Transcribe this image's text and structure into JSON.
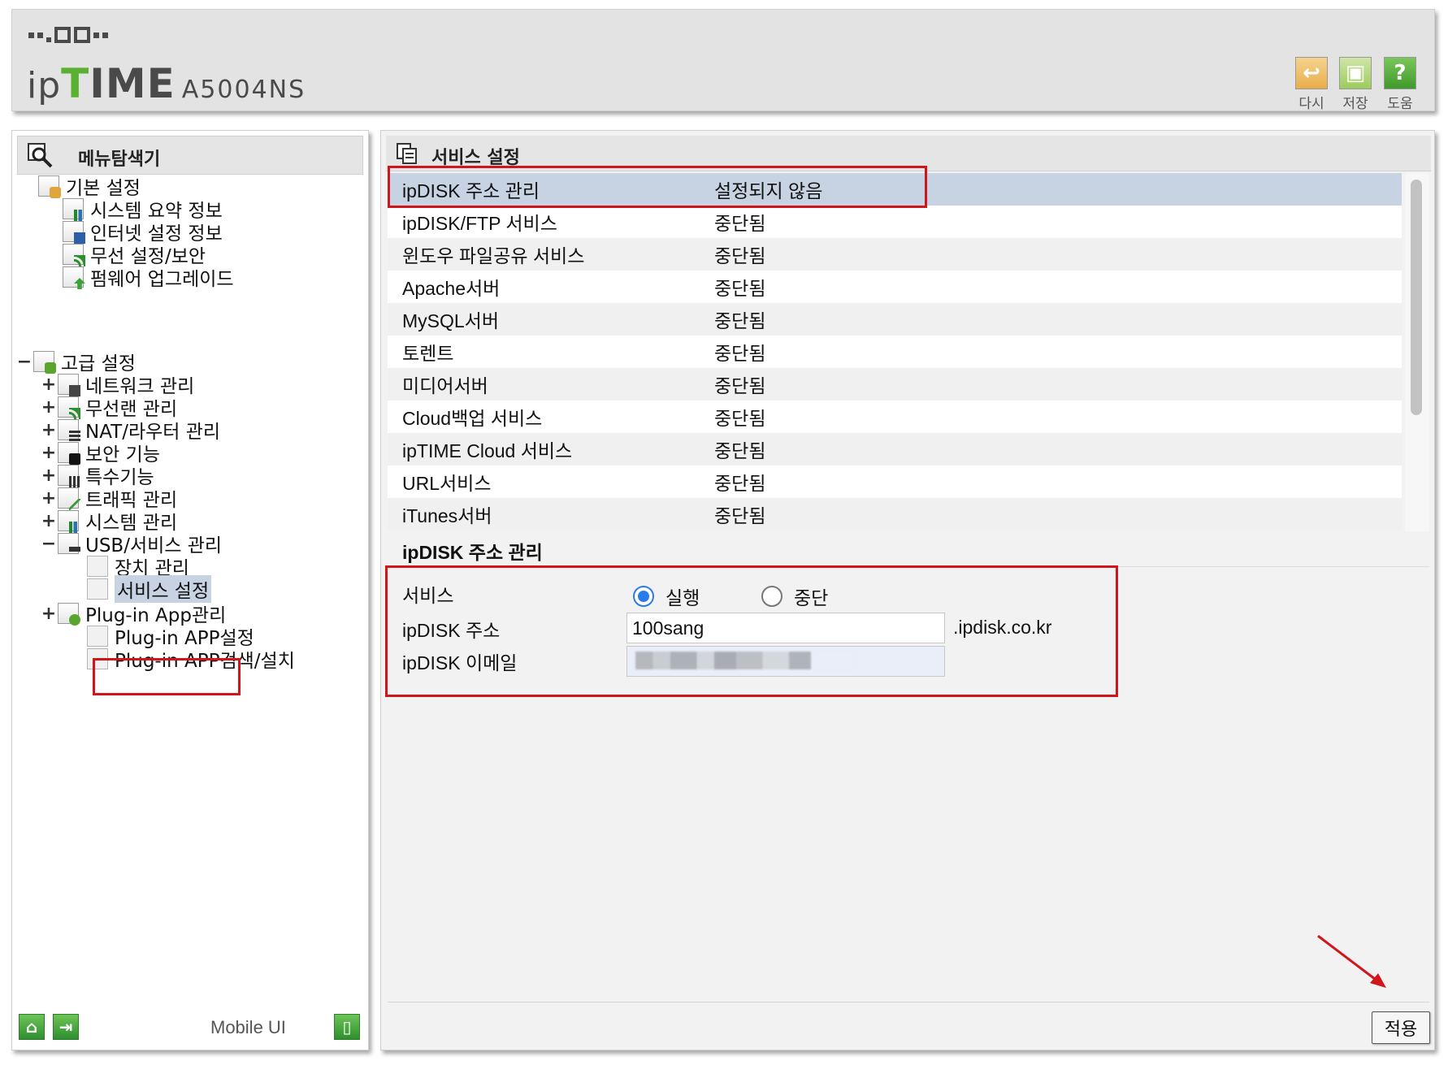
{
  "header": {
    "brand_ip": "ip",
    "brand_t": "T",
    "brand_ime": "IME",
    "model": "A5004NS",
    "buttons": [
      {
        "label": "다시",
        "icon": "undo-icon"
      },
      {
        "label": "저장",
        "icon": "save-icon"
      },
      {
        "label": "도움",
        "icon": "help-icon"
      }
    ]
  },
  "sidebar": {
    "title": "메뉴탐색기",
    "basic": {
      "label": "기본 설정",
      "items": [
        "시스템 요약 정보",
        "인터넷 설정 정보",
        "무선 설정/보안",
        "펌웨어 업그레이드"
      ]
    },
    "advanced": {
      "label": "고급 설정",
      "items": [
        "네트워크 관리",
        "무선랜 관리",
        "NAT/라우터 관리",
        "보안 기능",
        "특수기능",
        "트래픽 관리",
        "시스템 관리",
        "USB/서비스 관리"
      ],
      "usb_children": [
        "장치 관리",
        "서비스 설정"
      ],
      "plugin": "Plug-in App관리",
      "plugin_children": [
        "Plug-in APP설정",
        "Plug-in APP검색/설치"
      ]
    },
    "footer": {
      "mobile_ui": "Mobile UI"
    }
  },
  "main": {
    "title": "서비스 설정",
    "services": [
      {
        "name": "ipDISK 주소 관리",
        "status": "설정되지 않음",
        "selected": true
      },
      {
        "name": "ipDISK/FTP 서비스",
        "status": "중단됨"
      },
      {
        "name": "윈도우 파일공유 서비스",
        "status": "중단됨"
      },
      {
        "name": "Apache서버",
        "status": "중단됨"
      },
      {
        "name": "MySQL서버",
        "status": "중단됨"
      },
      {
        "name": "토렌트",
        "status": "중단됨"
      },
      {
        "name": "미디어서버",
        "status": "중단됨"
      },
      {
        "name": "Cloud백업 서비스",
        "status": "중단됨"
      },
      {
        "name": "ipTIME Cloud 서비스",
        "status": "중단됨"
      },
      {
        "name": "URL서비스",
        "status": "중단됨"
      },
      {
        "name": "iTunes서버",
        "status": "중단됨"
      }
    ],
    "section_title": "ipDISK 주소 관리",
    "form": {
      "service_label": "서비스",
      "run_label": "실행",
      "stop_label": "중단",
      "selected": "실행",
      "address_label": "ipDISK 주소",
      "address_value": "100sang",
      "address_suffix": ".ipdisk.co.kr",
      "email_label": "ipDISK 이메일"
    },
    "apply_label": "적용"
  },
  "colors": {
    "highlight": "#d0151b",
    "selection": "#c7d2e3",
    "radio_accent": "#2a7bea",
    "brand_green": "#5ab031"
  }
}
